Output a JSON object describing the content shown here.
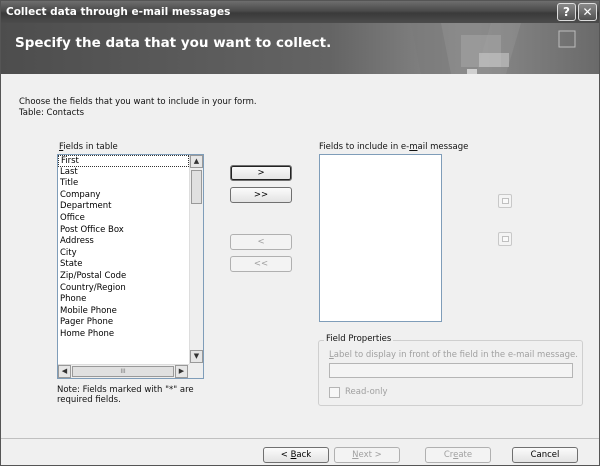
{
  "window": {
    "title": "Collect data through e-mail messages",
    "help_glyph": "?",
    "close_glyph": "✕"
  },
  "banner": {
    "heading": "Specify the data that you want to collect."
  },
  "intro": {
    "line1": "Choose the fields that you want to include in your form.",
    "line2": "Table: Contacts"
  },
  "fields_in_table": {
    "label_accel": "F",
    "label_rest": "ields in table",
    "items": [
      "First",
      "Last",
      "Title",
      "Company",
      "Department",
      "Office",
      "Post Office Box",
      "Address",
      "City",
      "State",
      "Zip/Postal Code",
      "Country/Region",
      "Phone",
      "Mobile Phone",
      "Pager Phone",
      "Home Phone"
    ],
    "selected": "First"
  },
  "scroll": {
    "up": "▲",
    "down": "▼",
    "left": "◀",
    "right": "▶",
    "grip": "III"
  },
  "move_buttons": {
    "add_one": ">",
    "add_all": ">>",
    "remove_one": "<",
    "remove_all": "<<"
  },
  "fields_to_include": {
    "label_pre": "Fields to include in e-",
    "label_accel": "m",
    "label_post": "ail message",
    "items": []
  },
  "field_properties": {
    "title": "Field Properties",
    "label_accel": "L",
    "label_rest": "abel to display in front of the field in the e-mail message.",
    "input_value": "",
    "readonly_label": "Read-only"
  },
  "note": {
    "text": "Note: Fields marked with \"*\" are required fields."
  },
  "footer": {
    "back_pre": "< ",
    "back_accel": "B",
    "back_post": "ack",
    "next_accel": "N",
    "next_post": "ext >",
    "create_pre": "Cr",
    "create_accel": "e",
    "create_post": "ate",
    "cancel": "Cancel"
  },
  "colors": {
    "title_bar": "#4a4a4a",
    "banner": "#646464",
    "dialog_bg": "#f0f0f0",
    "list_border": "#7f9db9"
  }
}
